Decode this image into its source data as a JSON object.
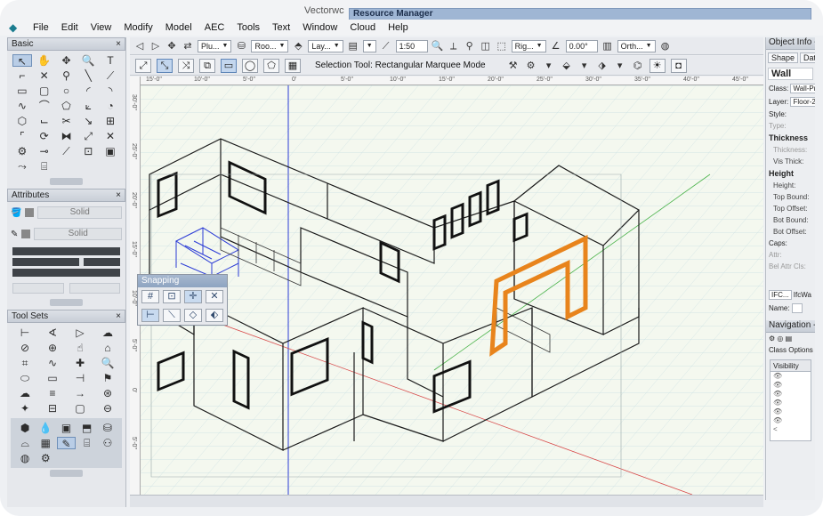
{
  "app": {
    "title": "Vectorwc",
    "resource_window": "Resource Manager",
    "logo_icon": "app-logo-icon"
  },
  "menu": [
    "File",
    "Edit",
    "View",
    "Modify",
    "Model",
    "AEC",
    "Tools",
    "Text",
    "Window",
    "Cloud",
    "Help"
  ],
  "toolbar": {
    "plane": "Plu...",
    "class": "Roo...",
    "layer": "Lay...",
    "scale": "1:50",
    "render": "Rig...",
    "angle": "0.00°",
    "view": "Orth..."
  },
  "mode_bar": {
    "status": "Selection Tool: Rectangular Marquee Mode"
  },
  "ruler": {
    "top": [
      "15'-0\"",
      "10'-0\"",
      "5'-0\"",
      "0'",
      "5'-0\"",
      "10'-0\"",
      "15'-0\"",
      "20'-0\"",
      "25'-0\"",
      "30'-0\"",
      "35'-0\"",
      "40'-0\"",
      "45'-0\""
    ],
    "left": [
      "30'-0\"",
      "25'-0\"",
      "20'-0\"",
      "15'-0\"",
      "10'-0\"",
      "5'-0\"",
      "0'",
      "5'-0\""
    ]
  },
  "palettes": {
    "basic": {
      "title": "Basic",
      "close": "×"
    },
    "attributes": {
      "title": "Attributes",
      "close": "×",
      "fill": "Solid",
      "pen": "Solid"
    },
    "toolsets": {
      "title": "Tool Sets",
      "close": "×"
    }
  },
  "snapping": {
    "title": "Snapping"
  },
  "obj_info": {
    "title": "Object Info -",
    "tabs": [
      "Shape",
      "Data"
    ],
    "object": "Wall",
    "class_label": "Class:",
    "class_value": "Wall-Pr",
    "layer_label": "Layer:",
    "layer_value": "Floor-2",
    "style_label": "Style:",
    "type_label": "Type:",
    "thickness_head": "Thickness",
    "thickness": "Thickness:",
    "vis_thick": "Vis Thick:",
    "height_head": "Height",
    "height": "Height:",
    "top_bound": "Top Bound:",
    "top_offset": "Top Offset:",
    "bot_bound": "Bot Bound:",
    "bot_offset": "Bot Offset:",
    "caps": "Caps:",
    "attr": "Attr:",
    "bel_attr": "Bel Attr Cls:",
    "ifc": "IFC...",
    "ifc_value": "IfcWa",
    "name_label": "Name:"
  },
  "navigation": {
    "title": "Navigation -",
    "class_options": "Class Options",
    "visibility": "Visibility",
    "scroll_left": "<"
  },
  "colors": {
    "accent_orange": "#e8841c",
    "selection_blue": "#2b3bd6",
    "axis_red": "#d84a4a",
    "axis_green": "#4bb34b"
  }
}
